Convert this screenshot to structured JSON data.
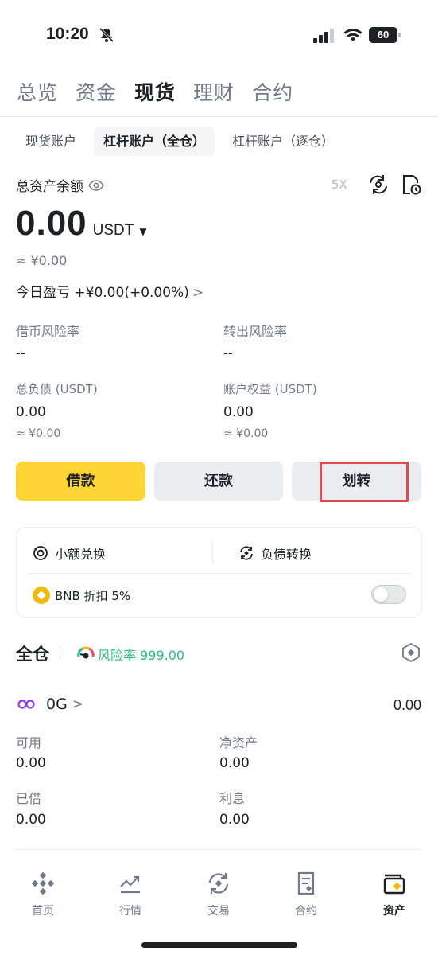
{
  "status_bar": {
    "time": "10:20",
    "battery": "60"
  },
  "top_tabs": [
    {
      "label": "总览",
      "active": false
    },
    {
      "label": "资金",
      "active": false
    },
    {
      "label": "现货",
      "active": true
    },
    {
      "label": "理财",
      "active": false
    },
    {
      "label": "合约",
      "active": false
    }
  ],
  "sub_tabs": [
    {
      "label": "现货账户",
      "active": false
    },
    {
      "label": "杠杆账户（全仓）",
      "active": true
    },
    {
      "label": "杠杆账户（逐仓）",
      "active": false
    }
  ],
  "summary": {
    "total_label": "总资产余额",
    "leverage": "5X",
    "balance": "0.00",
    "currency": "USDT",
    "approx": "≈ ¥0.00",
    "pnl_label": "今日盈亏 +¥0.00(+0.00%)",
    "chevron": ">"
  },
  "risk": {
    "borrow_risk_label": "借币风险率",
    "borrow_risk_value": "--",
    "transfer_risk_label": "转出风险率",
    "transfer_risk_value": "--"
  },
  "liabilities": {
    "total_debt_label": "总负债 (USDT)",
    "total_debt_value": "0.00",
    "total_debt_approx": "≈ ¥0.00",
    "equity_label": "账户权益 (USDT)",
    "equity_value": "0.00",
    "equity_approx": "≈ ¥0.00"
  },
  "actions": {
    "borrow": "借款",
    "repay": "还款",
    "transfer": "划转"
  },
  "tools": {
    "small_convert": "小额兑换",
    "debt_convert": "负债转换",
    "bnb_discount": "BNB 折扣 5%",
    "bnb_toggle_on": false
  },
  "cross_margin": {
    "title": "全仓",
    "risk_rate": "风险率 999.00",
    "risk_color": "#2ebd85"
  },
  "asset": {
    "coin": "0G",
    "chevron": ">",
    "total": "0.00",
    "available_label": "可用",
    "available_value": "0.00",
    "net_asset_label": "净资产",
    "net_asset_value": "0.00",
    "borrowed_label": "已借",
    "borrowed_value": "0.00",
    "interest_label": "利息",
    "interest_value": "0.00"
  },
  "bottom_nav": [
    {
      "label": "首页",
      "icon": "home-icon",
      "active": false
    },
    {
      "label": "行情",
      "icon": "markets-icon",
      "active": false
    },
    {
      "label": "交易",
      "icon": "trade-icon",
      "active": false
    },
    {
      "label": "合约",
      "icon": "futures-icon",
      "active": false
    },
    {
      "label": "资产",
      "icon": "wallet-icon",
      "active": true
    }
  ],
  "colors": {
    "accent": "#fcd535",
    "highlight_box": "#e14a4a",
    "text_secondary": "#707a8a"
  }
}
